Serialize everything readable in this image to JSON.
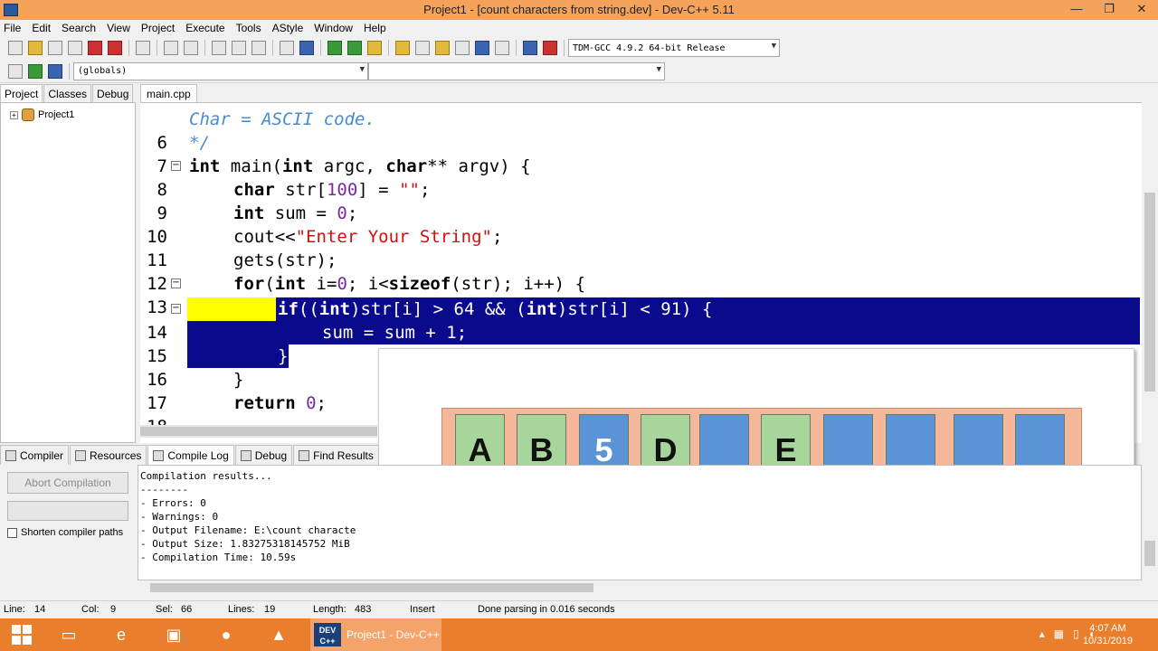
{
  "window": {
    "title": "Project1 - [count characters from string.dev] - Dev-C++ 5.11",
    "controls": [
      "—",
      "❐",
      "✕"
    ]
  },
  "menu": [
    "File",
    "Edit",
    "Search",
    "View",
    "Project",
    "Execute",
    "Tools",
    "AStyle",
    "Window",
    "Help"
  ],
  "toolbar": {
    "compiler_select": "TDM-GCC 4.9.2 64-bit Release",
    "scope_select": "(globals)"
  },
  "left_tabs": [
    "Project",
    "Classes",
    "Debug"
  ],
  "project_tree": {
    "root": "Project1"
  },
  "editor_tab": "main.cpp",
  "code_lines": [
    {
      "n": "6"
    },
    {
      "n": "7"
    },
    {
      "n": "8"
    },
    {
      "n": "9"
    },
    {
      "n": "10"
    },
    {
      "n": "11"
    },
    {
      "n": "12"
    },
    {
      "n": "13"
    },
    {
      "n": "14"
    },
    {
      "n": "15"
    },
    {
      "n": "16"
    },
    {
      "n": "17"
    },
    {
      "n": "18"
    }
  ],
  "code_text": {
    "l6": "Char = ASCII code.",
    "l7": "*/",
    "l8_kw1": "int",
    "l8_a": " main(",
    "l8_kw2": "int",
    "l8_b": " argc, ",
    "l8_kw3": "char",
    "l8_c": "** argv) {",
    "l9_kw": "char",
    "l9_a": " str[",
    "l9_num": "100",
    "l9_b": "] = ",
    "l9_str": "\"\"",
    "l9_c": ";",
    "l10_kw": "int",
    "l10_a": " sum = ",
    "l10_num": "0",
    "l10_b": ";",
    "l11_a": "cout<<",
    "l11_str": "\"Enter Your String\"",
    "l11_b": ";",
    "l12": "gets(str);",
    "l13_kw1": "for",
    "l13_a": "(",
    "l13_kw2": "int",
    "l13_b": " i=",
    "l13_num": "0",
    "l13_c": "; i<",
    "l13_kw3": "sizeof",
    "l13_d": "(str); i++) {",
    "l14_kw1": "if",
    "l14_a": "((",
    "l14_kw2": "int",
    "l14_b": ")str[i] > 64 && (",
    "l14_kw3": "int",
    "l14_c": ")str[i] < 91) {",
    "l15": "sum = sum + 1;",
    "l16": "}",
    "l17": "}",
    "l18_kw": "return",
    "l18_num": "0",
    "l18_a": ";"
  },
  "overlay_array": {
    "cells": [
      {
        "label": "A",
        "color": "green"
      },
      {
        "label": "B",
        "color": "green"
      },
      {
        "label": "5",
        "color": "blue"
      },
      {
        "label": "D",
        "color": "green"
      },
      {
        "label": "",
        "color": "blue"
      },
      {
        "label": "E",
        "color": "green"
      },
      {
        "label": "",
        "color": "blue"
      },
      {
        "label": "",
        "color": "blue"
      },
      {
        "label": "",
        "color": "blue"
      },
      {
        "label": "",
        "color": "blue"
      }
    ]
  },
  "bottom_tabs": [
    "Compiler",
    "Resources",
    "Compile Log",
    "Debug",
    "Find Results"
  ],
  "compile_panel": {
    "abort_label": "Abort Compilation",
    "shorten_label": "Shorten compiler paths"
  },
  "compile_log": [
    "Compilation results...",
    "--------",
    "- Errors: 0",
    "- Warnings: 0",
    "- Output Filename: E:\\count characte",
    "- Output Size: 1.83275318145752 MiB",
    "- Compilation Time: 10.59s"
  ],
  "status": {
    "line_label": "Line:",
    "line_value": "14",
    "col_label": "Col:",
    "col_value": "9",
    "sel_label": "Sel:",
    "sel_value": "66",
    "lines_label": "Lines:",
    "lines_value": "19",
    "length_label": "Length:",
    "length_value": "483",
    "mode": "Insert",
    "message": "Done parsing in 0.016 seconds"
  },
  "taskbar": {
    "running_app": "Project1 - Dev-C++",
    "dev_icon": "DEV C++",
    "time": "4:07 AM",
    "date": "10/31/2019"
  },
  "colors": {
    "title_bar": "#f5a25a",
    "taskbar": "#e97f2c",
    "selection": "#0a0a8c",
    "current_line": "#ffff00",
    "cell_green": "#a8d59b",
    "cell_blue": "#5b94d6",
    "array_bg": "#f5b79a"
  }
}
